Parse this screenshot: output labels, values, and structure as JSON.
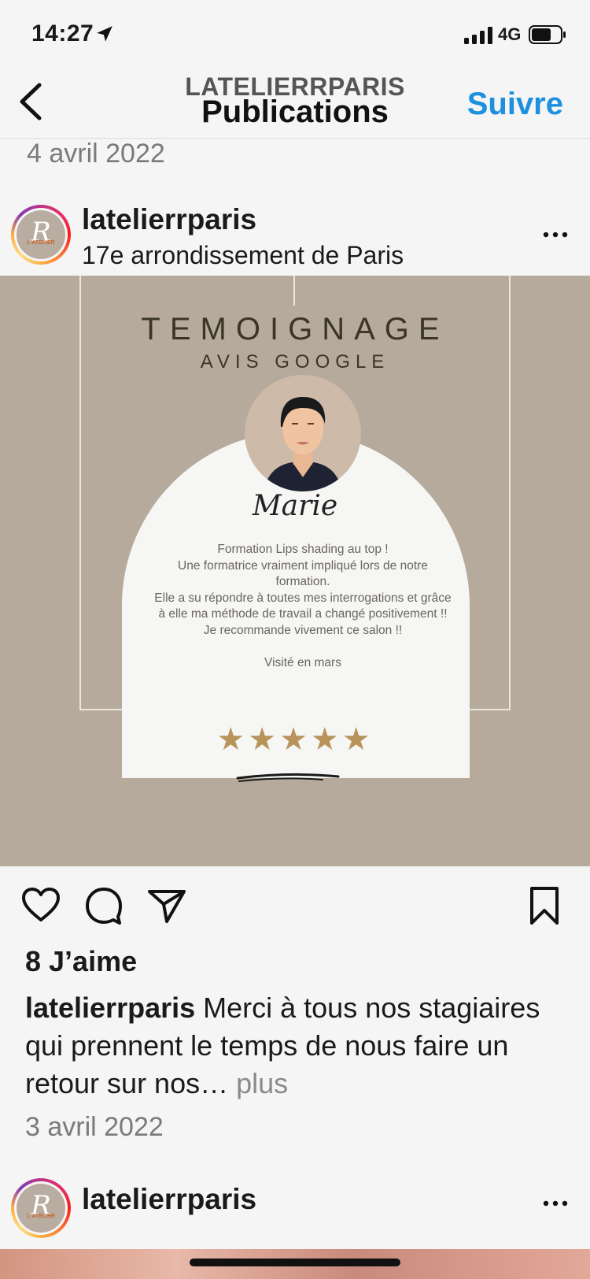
{
  "status_bar": {
    "time": "14:27",
    "network": "4G"
  },
  "nav": {
    "subtitle": "LATELIERRPARIS",
    "title": "Publications",
    "follow_label": "Suivre"
  },
  "previous_date": "4 avril 2022",
  "post": {
    "username": "latelierrparis",
    "location": "17e arrondissement de Paris",
    "avatar_letter": "R",
    "avatar_text": "L'ATELIER",
    "image": {
      "title": "TEMOIGNAGE",
      "subtitle": "AVIS GOOGLE",
      "signature": "Marie",
      "review_lines": [
        "Formation Lips shading au top !",
        "Une formatrice  vraiment impliqué lors de notre formation.",
        "Elle a su répondre à toutes mes interrogations et grâce à elle ma méthode de travail a changé positivement !!",
        "Je recommande vivement ce salon !!"
      ],
      "visit": "Visité en mars",
      "rating": 5,
      "star_color": "#b8935a",
      "background_color": "#b6aa9c"
    },
    "actions": [
      "like-icon",
      "comment-icon",
      "share-icon",
      "save-icon"
    ],
    "likes": "8 J’aime",
    "caption_user": "latelierrparis",
    "caption_text": " Merci à tous nos stagiaires qui prennent le temps de nous faire un retour sur nos…",
    "caption_more": " plus",
    "date": "3 avril 2022"
  },
  "next_post": {
    "username": "latelierrparis",
    "avatar_letter": "R",
    "avatar_text": "L'ATELIER"
  },
  "colors": {
    "accent": "#1d91e0",
    "background": "#f5f5f5"
  }
}
